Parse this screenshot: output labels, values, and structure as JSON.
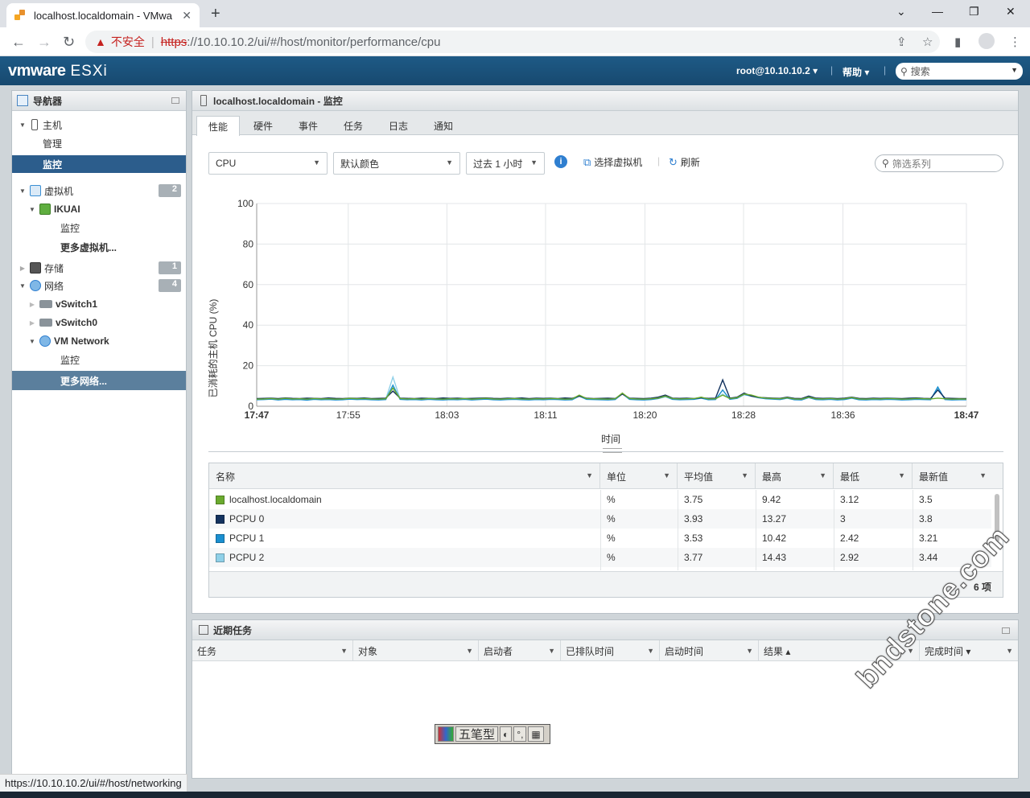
{
  "browser": {
    "tab_title": "localhost.localdomain - VMwa",
    "new_tab": "+",
    "insecure_label": "不安全",
    "url_scheme": "https",
    "url_rest": "://10.10.10.2/ui/#/host/monitor/performance/cpu",
    "status_url": "https://10.10.10.2/ui/#/host/networking"
  },
  "esxi": {
    "logo_brand": "vmware",
    "logo_product": "ESXi",
    "user": "root@10.10.10.2 ▾",
    "help": "帮助 ▾",
    "search_placeholder": "搜索"
  },
  "navigator": {
    "title": "导航器",
    "items": [
      {
        "label": "主机",
        "badge": ""
      },
      {
        "label": "管理"
      },
      {
        "label": "监控"
      },
      {
        "label": "虚拟机",
        "badge": "2"
      },
      {
        "label": "IKUAI"
      },
      {
        "label": "监控"
      },
      {
        "label": "更多虚拟机..."
      },
      {
        "label": "存储",
        "badge": "1"
      },
      {
        "label": "网络",
        "badge": "4"
      },
      {
        "label": "vSwitch1"
      },
      {
        "label": "vSwitch0"
      },
      {
        "label": "VM Network"
      },
      {
        "label": "监控"
      },
      {
        "label": "更多网络..."
      }
    ]
  },
  "main": {
    "title": "localhost.localdomain - 监控",
    "tabs": [
      "性能",
      "硬件",
      "事件",
      "任务",
      "日志",
      "通知"
    ],
    "toolbar": {
      "metric": "CPU",
      "color": "默认颜色",
      "range": "过去 1 小时",
      "select_vm": "选择虚拟机",
      "refresh": "刷新",
      "filter_placeholder": "筛选系列"
    },
    "table": {
      "columns": [
        "名称",
        "单位",
        "平均值",
        "最高",
        "最低",
        "最新值"
      ],
      "rows": [
        {
          "name": "localhost.localdomain",
          "color": "#6aaa2e",
          "unit": "%",
          "avg": "3.75",
          "max": "9.42",
          "min": "3.12",
          "latest": "3.5"
        },
        {
          "name": "PCPU 0",
          "color": "#14335f",
          "unit": "%",
          "avg": "3.93",
          "max": "13.27",
          "min": "3",
          "latest": "3.8"
        },
        {
          "name": "PCPU 1",
          "color": "#1a8fd0",
          "unit": "%",
          "avg": "3.53",
          "max": "10.42",
          "min": "2.42",
          "latest": "3.21"
        },
        {
          "name": "PCPU 2",
          "color": "#8fd0e8",
          "unit": "%",
          "avg": "3.77",
          "max": "14.43",
          "min": "2.92",
          "latest": "3.44"
        }
      ],
      "count": "6 项"
    }
  },
  "recent_tasks": {
    "title": "近期任务",
    "columns": [
      "任务",
      "对象",
      "启动者",
      "已排队时间",
      "启动时间",
      "结果 ▴",
      "完成时间 ▾"
    ]
  },
  "ime": {
    "mode": "五笔型"
  },
  "watermark": "bndstone.com",
  "chart_data": {
    "type": "line",
    "ylabel": "已消耗的主机 CPU (%)",
    "xlabel": "时间",
    "ylim": [
      0,
      100
    ],
    "yticks": [
      0,
      20,
      40,
      60,
      80,
      100
    ],
    "xticks": [
      "17:47",
      "17:55",
      "18:03",
      "18:11",
      "18:20",
      "18:28",
      "18:36",
      "18:47"
    ],
    "grid": true,
    "series": [
      {
        "name": "localhost.localdomain",
        "color": "#6aaa2e",
        "values": [
          3.5,
          3.6,
          3.8,
          3.5,
          3.9,
          3.6,
          3.7,
          3.5,
          3.8,
          3.6,
          3.7,
          3.5,
          3.6,
          3.9,
          3.7,
          3.8,
          3.6,
          3.5,
          3.7,
          9.0,
          3.8,
          3.6,
          3.7,
          3.5,
          3.8,
          3.6,
          3.5,
          3.7,
          3.6,
          3.8,
          3.5,
          3.7,
          3.9,
          3.6,
          3.5,
          3.7,
          3.8,
          3.6,
          3.5,
          3.7,
          3.6,
          3.8,
          3.7,
          3.5,
          3.6,
          5.5,
          3.8,
          3.7,
          3.6,
          3.5,
          3.7,
          6.5,
          3.8,
          3.6,
          3.5,
          3.7,
          4.0,
          5.0,
          3.8,
          3.6,
          3.7,
          3.8,
          4.5,
          3.6,
          3.7,
          5.5,
          3.8,
          4.2,
          6.0,
          5.5,
          4.5,
          4.0,
          3.8,
          3.7,
          4.2,
          3.6,
          3.5,
          4.5,
          3.7,
          3.6,
          3.8,
          3.5,
          3.7,
          4.3,
          3.6,
          3.5,
          3.7,
          3.6,
          3.8,
          3.7,
          3.5,
          3.6,
          3.8,
          3.7,
          3.6,
          4.0,
          3.7,
          3.5,
          3.6,
          3.5
        ]
      },
      {
        "name": "PCPU 0",
        "color": "#14335f",
        "values": [
          3.8,
          3.9,
          4.0,
          3.8,
          4.1,
          3.9,
          3.8,
          4.0,
          3.9,
          3.8,
          4.1,
          3.9,
          3.8,
          4.0,
          3.9,
          4.1,
          3.8,
          3.9,
          4.0,
          7.5,
          4.0,
          3.9,
          3.8,
          4.0,
          3.9,
          3.8,
          4.1,
          3.9,
          4.0,
          3.8,
          3.9,
          4.0,
          4.1,
          3.9,
          3.8,
          4.0,
          3.9,
          4.1,
          3.8,
          4.0,
          3.9,
          4.0,
          3.8,
          4.1,
          3.9,
          5.0,
          4.0,
          3.8,
          3.9,
          4.0,
          3.8,
          6.0,
          4.0,
          3.9,
          3.8,
          4.0,
          4.5,
          5.5,
          4.0,
          3.9,
          4.0,
          3.8,
          4.2,
          3.9,
          4.0,
          13.0,
          4.0,
          4.5,
          6.5,
          5.0,
          4.4,
          4.2,
          4.0,
          3.9,
          4.5,
          3.9,
          3.8,
          5.0,
          4.0,
          3.9,
          4.0,
          3.8,
          4.0,
          4.5,
          3.9,
          3.8,
          4.0,
          3.9,
          4.0,
          3.9,
          3.8,
          4.0,
          4.1,
          3.9,
          3.8,
          8.0,
          4.0,
          3.9,
          3.8,
          3.8
        ]
      },
      {
        "name": "PCPU 1",
        "color": "#1a8fd0",
        "values": [
          3.2,
          3.3,
          3.5,
          3.1,
          3.4,
          3.2,
          3.3,
          3.0,
          3.4,
          3.2,
          3.3,
          3.1,
          3.2,
          3.5,
          3.3,
          3.4,
          3.2,
          3.1,
          3.3,
          10.4,
          3.4,
          3.2,
          3.3,
          3.1,
          3.4,
          3.2,
          3.1,
          3.3,
          3.2,
          3.4,
          3.1,
          3.3,
          3.5,
          3.2,
          3.1,
          3.3,
          3.4,
          3.2,
          3.1,
          3.3,
          3.2,
          3.4,
          3.3,
          3.1,
          3.2,
          5.0,
          3.4,
          3.3,
          3.2,
          3.1,
          3.3,
          6.2,
          3.4,
          3.2,
          3.1,
          3.3,
          3.8,
          4.8,
          3.4,
          3.2,
          3.3,
          3.4,
          4.0,
          3.2,
          3.3,
          8.0,
          3.4,
          3.9,
          5.8,
          5.0,
          4.2,
          3.7,
          3.5,
          3.3,
          4.0,
          3.2,
          3.1,
          4.3,
          3.3,
          3.2,
          3.4,
          3.1,
          3.3,
          4.0,
          3.2,
          3.1,
          3.3,
          3.2,
          3.4,
          3.3,
          3.1,
          3.2,
          3.4,
          3.3,
          3.2,
          9.5,
          3.3,
          3.1,
          3.2,
          3.2
        ]
      },
      {
        "name": "PCPU 2",
        "color": "#8fd0e8",
        "values": [
          3.4,
          3.5,
          3.7,
          3.3,
          3.6,
          3.4,
          3.5,
          3.3,
          3.6,
          3.4,
          3.5,
          3.3,
          3.4,
          3.7,
          3.5,
          3.6,
          3.4,
          3.3,
          3.5,
          14.4,
          3.6,
          3.4,
          3.5,
          3.3,
          3.6,
          3.4,
          3.3,
          3.5,
          3.4,
          3.6,
          3.3,
          3.5,
          3.7,
          3.4,
          3.3,
          3.5,
          3.6,
          3.4,
          3.3,
          3.5,
          3.4,
          3.6,
          3.5,
          3.3,
          3.4,
          5.2,
          3.6,
          3.5,
          3.4,
          3.3,
          3.5,
          6.4,
          3.6,
          3.4,
          3.3,
          3.5,
          3.9,
          4.9,
          3.6,
          3.4,
          3.5,
          3.6,
          4.3,
          3.4,
          3.5,
          6.0,
          3.6,
          4.0,
          5.9,
          5.2,
          4.3,
          3.9,
          3.7,
          3.5,
          4.1,
          3.4,
          3.3,
          4.4,
          3.5,
          3.4,
          3.6,
          3.3,
          3.5,
          4.2,
          3.4,
          3.3,
          3.5,
          3.4,
          3.6,
          3.5,
          3.3,
          3.4,
          3.6,
          3.5,
          3.4,
          9.0,
          3.5,
          3.3,
          3.4,
          3.4
        ]
      }
    ]
  }
}
